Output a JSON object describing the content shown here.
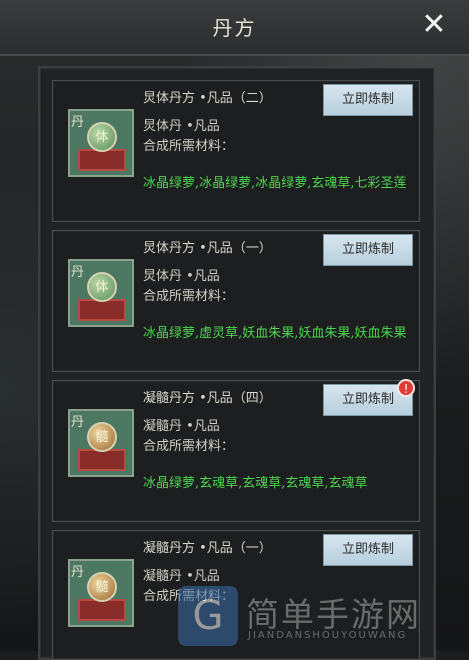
{
  "window": {
    "title": "丹方",
    "close_icon": "close-icon"
  },
  "recipes": [
    {
      "title": "炅体丹方 •凡品（二）",
      "button": "立即炼制",
      "product": "炅体丹 •凡品",
      "materials_label": "合成所需材料：",
      "materials": "冰晶绿萝,冰晶绿萝,冰晶绿萝,玄魂草,七彩圣莲",
      "icon_corner": "丹",
      "pill_char": "体",
      "pill_color": "green"
    },
    {
      "title": "炅体丹方 •凡品（一）",
      "button": "立即炼制",
      "product": "炅体丹 •凡品",
      "materials_label": "合成所需材料：",
      "materials": "冰晶绿萝,虚灵草,妖血朱果,妖血朱果,妖血朱果",
      "icon_corner": "丹",
      "pill_char": "体",
      "pill_color": "green"
    },
    {
      "title": "凝髓丹方 •凡品（四）",
      "button": "立即炼制",
      "product": "凝髓丹 •凡品",
      "materials_label": "合成所需材料：",
      "materials": "冰晶绿萝,玄魂草,玄魂草,玄魂草,玄魂草",
      "icon_corner": "丹",
      "pill_char": "髓",
      "pill_color": "gold",
      "alert": "!"
    },
    {
      "title": "凝髓丹方 •凡品（一）",
      "button": "立即炼制",
      "product": "凝髓丹 •凡品",
      "materials_label": "合成所需材料：",
      "materials": "",
      "icon_corner": "丹",
      "pill_char": "髓",
      "pill_color": "gold"
    }
  ],
  "watermark": {
    "logo": "G",
    "text": "简单手游网",
    "sub": "JIANDANSHOUYOUWANG"
  },
  "colors": {
    "material_green": "#4cd64e",
    "button_bg": "#c6dbe6",
    "icon_bg": "#4c7762",
    "alert_red": "#e23b34"
  }
}
